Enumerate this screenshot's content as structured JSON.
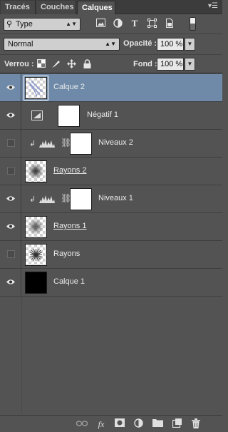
{
  "tabs": [
    {
      "label": "Tracés"
    },
    {
      "label": "Couches"
    },
    {
      "label": "Calques"
    }
  ],
  "panel_menu_icon": "panel-menu-icon",
  "filter": {
    "selected": "Type"
  },
  "blend": {
    "selected": "Normal"
  },
  "opacity": {
    "label": "Opacité :",
    "value": "100 %"
  },
  "lock": {
    "label": "Verrou :"
  },
  "fill": {
    "label": "Fond :",
    "value": "100 %"
  },
  "layers": [
    {
      "name": "Calque 2",
      "visible": true,
      "selected": true
    },
    {
      "name": "Négatif 1",
      "visible": true
    },
    {
      "name": "Niveaux 2",
      "visible": false
    },
    {
      "name": "Rayons 2",
      "visible": false
    },
    {
      "name": "Niveaux 1",
      "visible": true
    },
    {
      "name": "Rayons 1",
      "visible": true
    },
    {
      "name": "Rayons",
      "visible": false
    },
    {
      "name": "Calque 1",
      "visible": true
    }
  ],
  "colors": {
    "panel_bg": "#535353",
    "selected_row": "#6e8aa8",
    "tab_bar": "#3c3c3c"
  }
}
